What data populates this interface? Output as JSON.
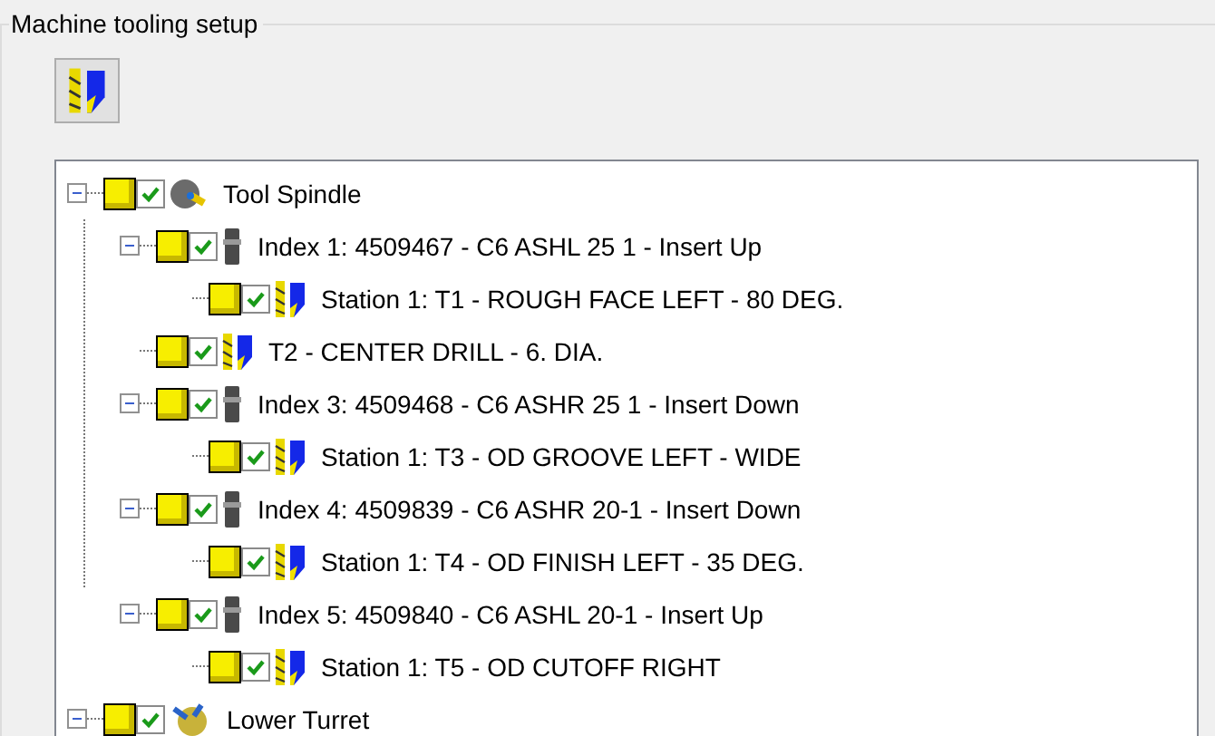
{
  "group_box": {
    "title": "Machine tooling setup"
  },
  "toolbar": {
    "tool_button": {
      "kind": "tool"
    }
  },
  "tree": [
    {
      "label": "Tool Spindle",
      "kind": "spindle",
      "checked": true,
      "expanded": true,
      "children": [
        {
          "label": "Index 1: 4509467 - C6 ASHL 25 1 - Insert Up",
          "kind": "holder",
          "checked": true,
          "expanded": true,
          "children": [
            {
              "label": "Station 1: T1 - ROUGH FACE LEFT - 80 DEG.",
              "kind": "tool",
              "checked": true
            }
          ]
        },
        {
          "label": "T2 - CENTER DRILL - 6. DIA.",
          "kind": "tool",
          "checked": true
        },
        {
          "label": "Index 3: 4509468 - C6 ASHR 25 1 - Insert Down",
          "kind": "holder",
          "checked": true,
          "expanded": true,
          "children": [
            {
              "label": "Station 1: T3 - OD GROOVE LEFT - WIDE",
              "kind": "tool",
              "checked": true
            }
          ]
        },
        {
          "label": "Index 4: 4509839 - C6 ASHR 20-1 - Insert Down",
          "kind": "holder",
          "checked": true,
          "expanded": true,
          "children": [
            {
              "label": "Station 1: T4 - OD FINISH LEFT - 35 DEG.",
              "kind": "tool",
              "checked": true
            }
          ]
        },
        {
          "label": "Index 5: 4509840 - C6 ASHL 20-1 - Insert Up",
          "kind": "holder",
          "checked": true,
          "expanded": true,
          "children": [
            {
              "label": "Station 1: T5 - OD CUTOFF RIGHT",
              "kind": "tool",
              "checked": true
            }
          ]
        }
      ]
    },
    {
      "label": "Lower Turret",
      "kind": "turret",
      "checked": true,
      "expanded": true
    }
  ]
}
